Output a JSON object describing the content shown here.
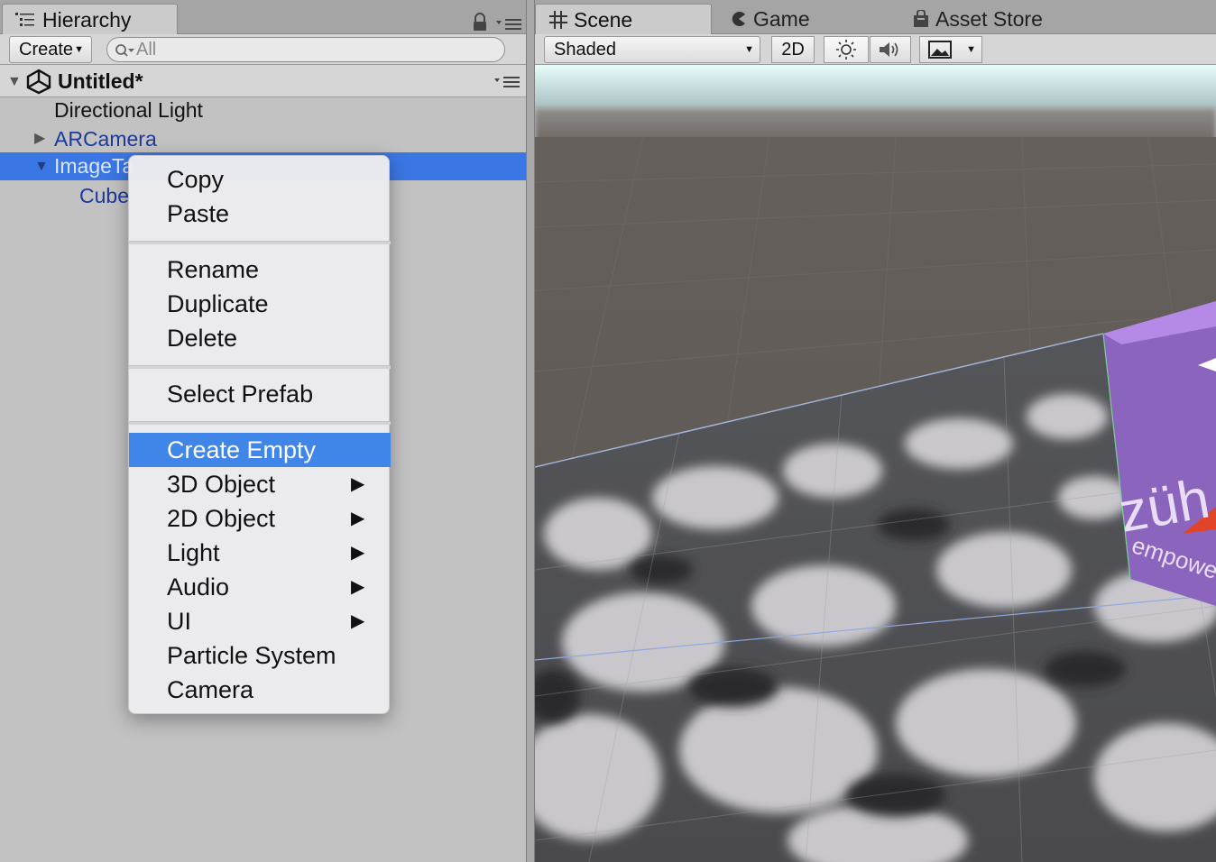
{
  "hierarchy": {
    "tab_label": "Hierarchy",
    "create_label": "Create",
    "search_placeholder": "All",
    "scene_name": "Untitled*",
    "rows": [
      {
        "label": "Directional Light"
      },
      {
        "label": "ARCamera"
      },
      {
        "label": "ImageTa"
      },
      {
        "label": "Cube"
      }
    ]
  },
  "scene_panel": {
    "tabs": [
      {
        "label": "Scene"
      },
      {
        "label": "Game"
      },
      {
        "label": "Asset Store"
      }
    ],
    "shading_mode": "Shaded",
    "mode_2d_label": "2D",
    "cube_text": "züh",
    "cube_subtext": "empoweri"
  },
  "context_menu": {
    "items": [
      {
        "label": "Copy"
      },
      {
        "label": "Paste"
      },
      {
        "label": "Rename"
      },
      {
        "label": "Duplicate"
      },
      {
        "label": "Delete"
      },
      {
        "label": "Select Prefab"
      },
      {
        "label": "Create Empty",
        "highlighted": true
      },
      {
        "label": "3D Object",
        "submenu": true
      },
      {
        "label": "2D Object",
        "submenu": true
      },
      {
        "label": "Light",
        "submenu": true
      },
      {
        "label": "Audio",
        "submenu": true
      },
      {
        "label": "UI",
        "submenu": true
      },
      {
        "label": "Particle System"
      },
      {
        "label": "Camera"
      }
    ],
    "highlight_color": "#3f86e8"
  },
  "colors": {
    "selection": "#3b77e4",
    "cube": "#9a6fd0"
  }
}
